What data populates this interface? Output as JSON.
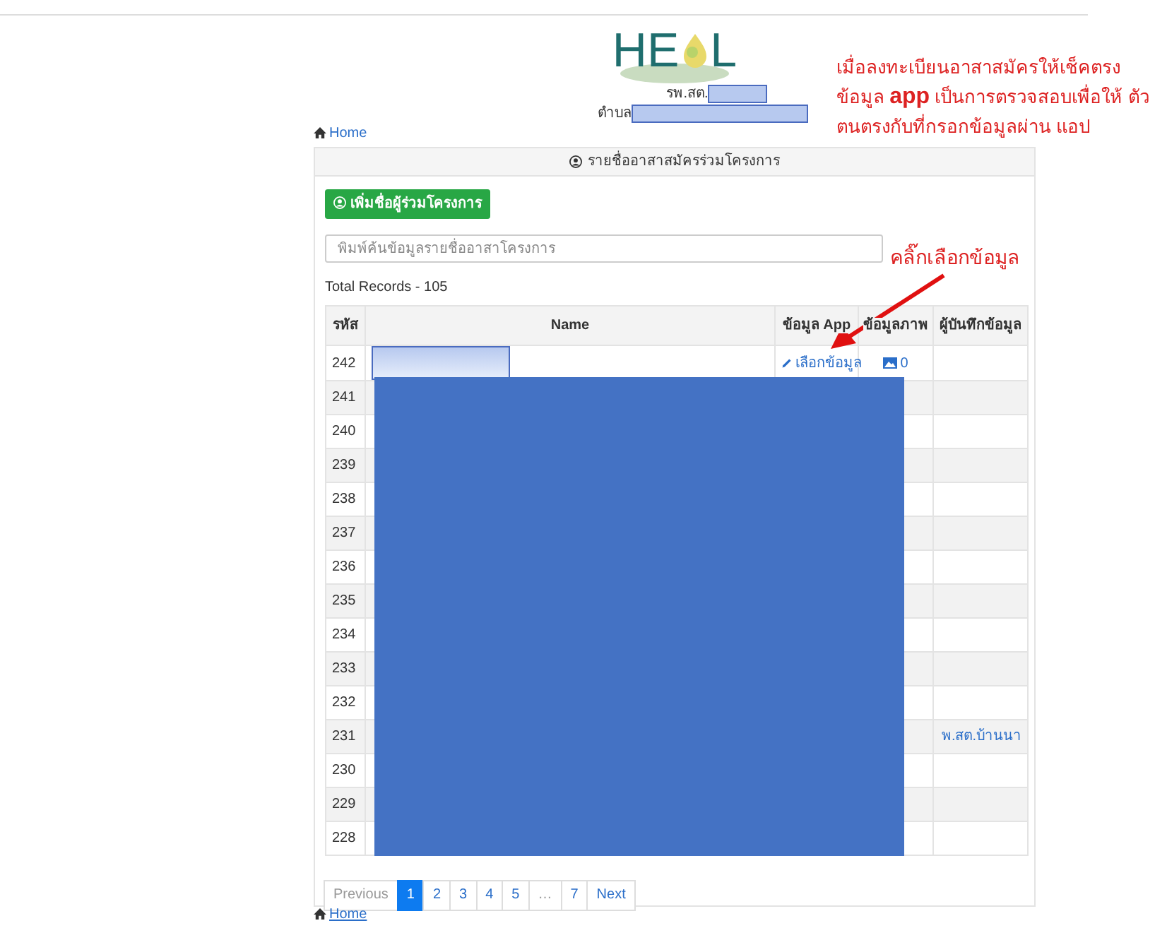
{
  "logo": {
    "left": "HE",
    "right": "L"
  },
  "facility": {
    "label": "รพ.สต.",
    "redacted": true
  },
  "district": {
    "label": "ตำบล",
    "redacted": true
  },
  "home_link_top": "Home",
  "card": {
    "title": "รายชื่ออาสาสมัครร่วมโครงการ",
    "add_button": "เพิ่มชื่อผู้ร่วมโครงการ",
    "search": {
      "placeholder": "พิมพ์ค้นข้อมูลรายชื่ออาสาโครงการ"
    },
    "total": "Total Records - 105",
    "table": {
      "columns": [
        "รหัส",
        "Name",
        "ข้อมูล App",
        "ข้อมูลภาพ",
        "ผู้บันทึกข้อมูล"
      ],
      "rows": [
        {
          "id": "242",
          "name_redacted": true,
          "app_link": "เลือกข้อมูล",
          "images": "0"
        },
        {
          "id": "241"
        },
        {
          "id": "240"
        },
        {
          "id": "239"
        },
        {
          "id": "238"
        },
        {
          "id": "237"
        },
        {
          "id": "236"
        },
        {
          "id": "235"
        },
        {
          "id": "234"
        },
        {
          "id": "233"
        },
        {
          "id": "232"
        },
        {
          "id": "231",
          "recorder": "พ.สต.บ้านนา"
        },
        {
          "id": "230"
        },
        {
          "id": "229"
        },
        {
          "id": "228"
        }
      ]
    },
    "redaction_block": true,
    "pagination": [
      {
        "label": "Previous",
        "selected": false,
        "disabled": true
      },
      {
        "label": "1",
        "selected": true,
        "disabled": false
      },
      {
        "label": "2",
        "selected": false,
        "disabled": false
      },
      {
        "label": "3",
        "selected": false,
        "disabled": false
      },
      {
        "label": "4",
        "selected": false,
        "disabled": false
      },
      {
        "label": "5",
        "selected": false,
        "disabled": false
      },
      {
        "label": "…",
        "selected": false,
        "disabled": true
      },
      {
        "label": "7",
        "selected": false,
        "disabled": false
      },
      {
        "label": "Next",
        "selected": false,
        "disabled": false
      }
    ]
  },
  "home_link_bottom": "Home",
  "annotations": [
    {
      "kind": "note",
      "text": "เมื่อลงทะเบียนอาสาสมัครให้เช็คตรง ข้อมูล **app** เป็นการตรวจสอบเพื่อให้ ตัวตนตรงกับที่กรอกข้อมูลผ่าน แอป"
    },
    {
      "kind": "pointer",
      "text": "คลิ๊กเลือกข้อมูล"
    }
  ]
}
